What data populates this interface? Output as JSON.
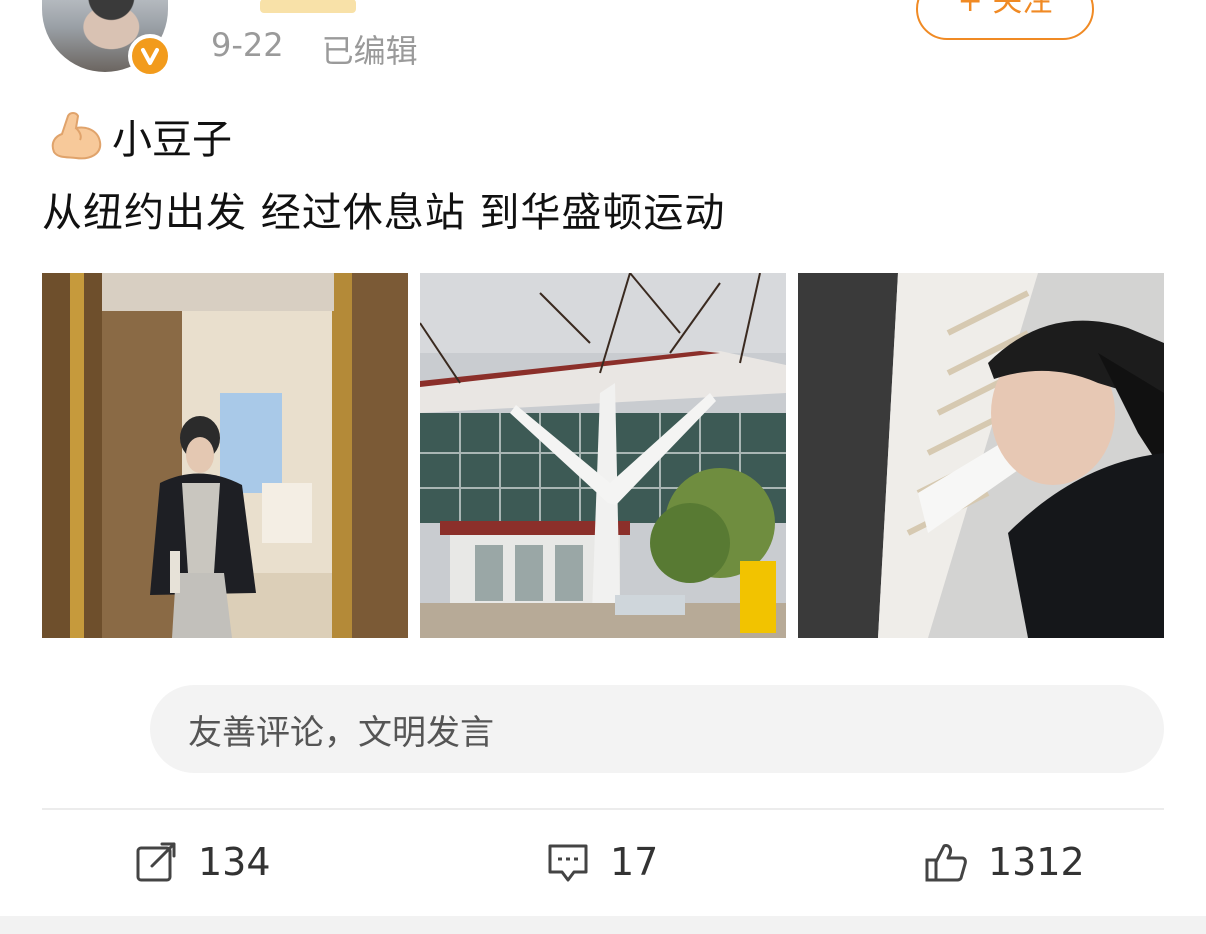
{
  "post": {
    "date": "9-22",
    "edited_label": "已编辑",
    "follow_label": "+ 关注",
    "line1_text": "小豆子",
    "line1_emoji": "flexed-biceps-emoji",
    "line2_text": "从纽约出发 经过休息站 到华盛顿运动"
  },
  "photos": [
    {
      "name": "mirror-selfie-photo"
    },
    {
      "name": "welcome-center-photo"
    },
    {
      "name": "headband-portrait-photo"
    }
  ],
  "comment": {
    "placeholder": "友善评论，文明发言"
  },
  "actions": {
    "repost_count": "134",
    "comment_count": "17",
    "like_count": "1312"
  },
  "colors": {
    "accent": "#f08a24",
    "verified_badge": "#f29b1c",
    "muted_text": "#9a9a9a",
    "comment_bg": "#f3f3f3"
  },
  "icons": [
    "repost-icon",
    "comment-icon",
    "like-icon",
    "verified-v-icon"
  ]
}
